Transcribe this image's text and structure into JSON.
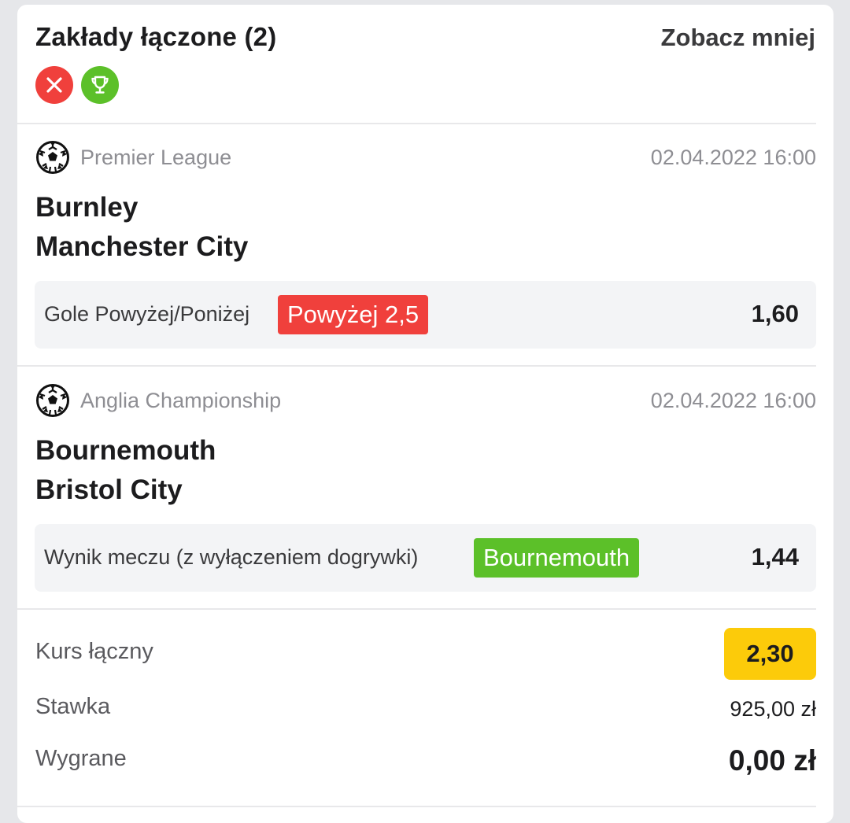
{
  "header": {
    "title": "Zakłady łączone (2)",
    "toggle_label": "Zobacz mniej",
    "status_icons": [
      {
        "icon": "close-icon",
        "color": "#f0403c",
        "meaning": "lost"
      },
      {
        "icon": "trophy-icon",
        "color": "#5cc029",
        "meaning": "won"
      }
    ]
  },
  "events": [
    {
      "sport_icon": "soccer-ball-icon",
      "league": "Premier League",
      "datetime": "02.04.2022 16:00",
      "home_team": "Burnley",
      "away_team": "Manchester City",
      "market": "Gole Powyżej/Poniżej",
      "pick": "Powyżej 2,5",
      "pick_color": "#f0403c",
      "odds": "1,60"
    },
    {
      "sport_icon": "soccer-ball-icon",
      "league": "Anglia Championship",
      "datetime": "02.04.2022 16:00",
      "home_team": "Bournemouth",
      "away_team": "Bristol City",
      "market": "Wynik meczu (z wyłączeniem dogrywki)",
      "pick": "Bournemouth",
      "pick_color": "#5cc029",
      "odds": "1,44"
    }
  ],
  "summary": {
    "total_odds_label": "Kurs łączny",
    "total_odds": "2,30",
    "total_odds_color": "#fccb0a",
    "stake_label": "Stawka",
    "stake": "925,00 zł",
    "winnings_label": "Wygrane",
    "winnings": "0,00 zł"
  }
}
